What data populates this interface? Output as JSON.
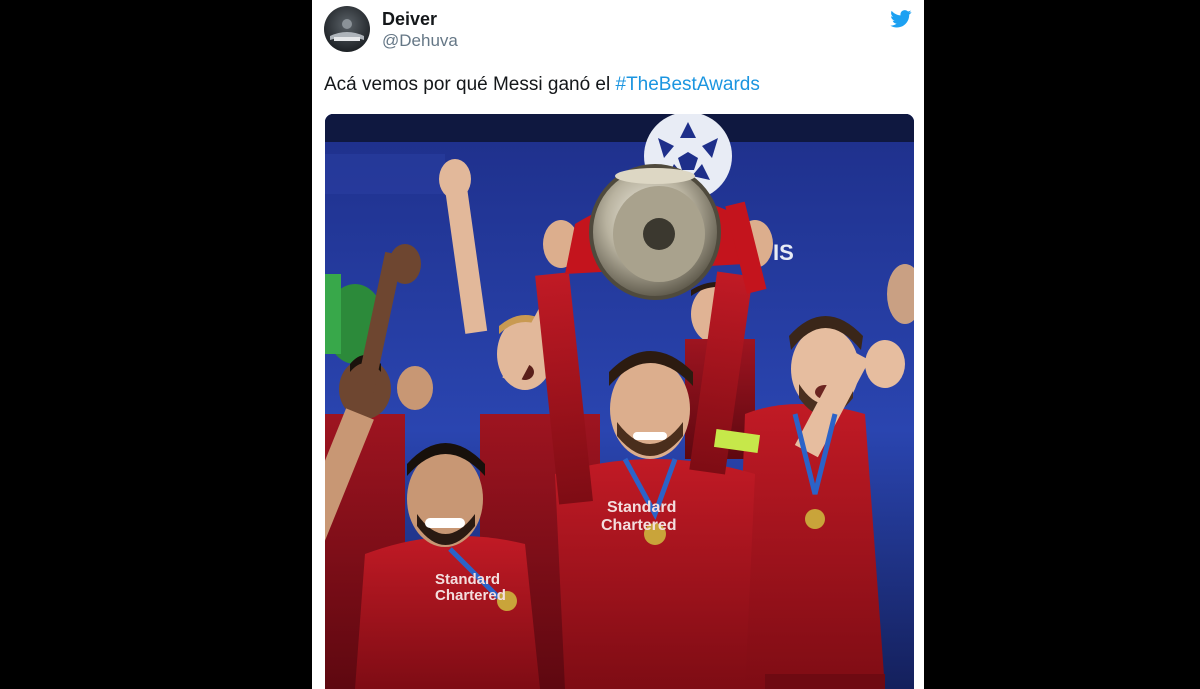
{
  "tweet": {
    "author": {
      "display_name": "Deiver",
      "handle": "@Dehuva"
    },
    "text": {
      "prefix": "Acá vemos por qué Messi ganó el ",
      "hashtag": "#TheBestAwards"
    },
    "media": {
      "shirt_text_1": "Standard",
      "shirt_text_2": "Chartered",
      "banner_text": "IS"
    }
  },
  "icons": {
    "brand": "twitter-bird-icon"
  },
  "colors": {
    "page_background": "#000000",
    "card_background": "#ffffff",
    "hashtag": "#1b95e0",
    "twitter_blue": "#1da1f2",
    "kit_red": "#b3121d"
  }
}
